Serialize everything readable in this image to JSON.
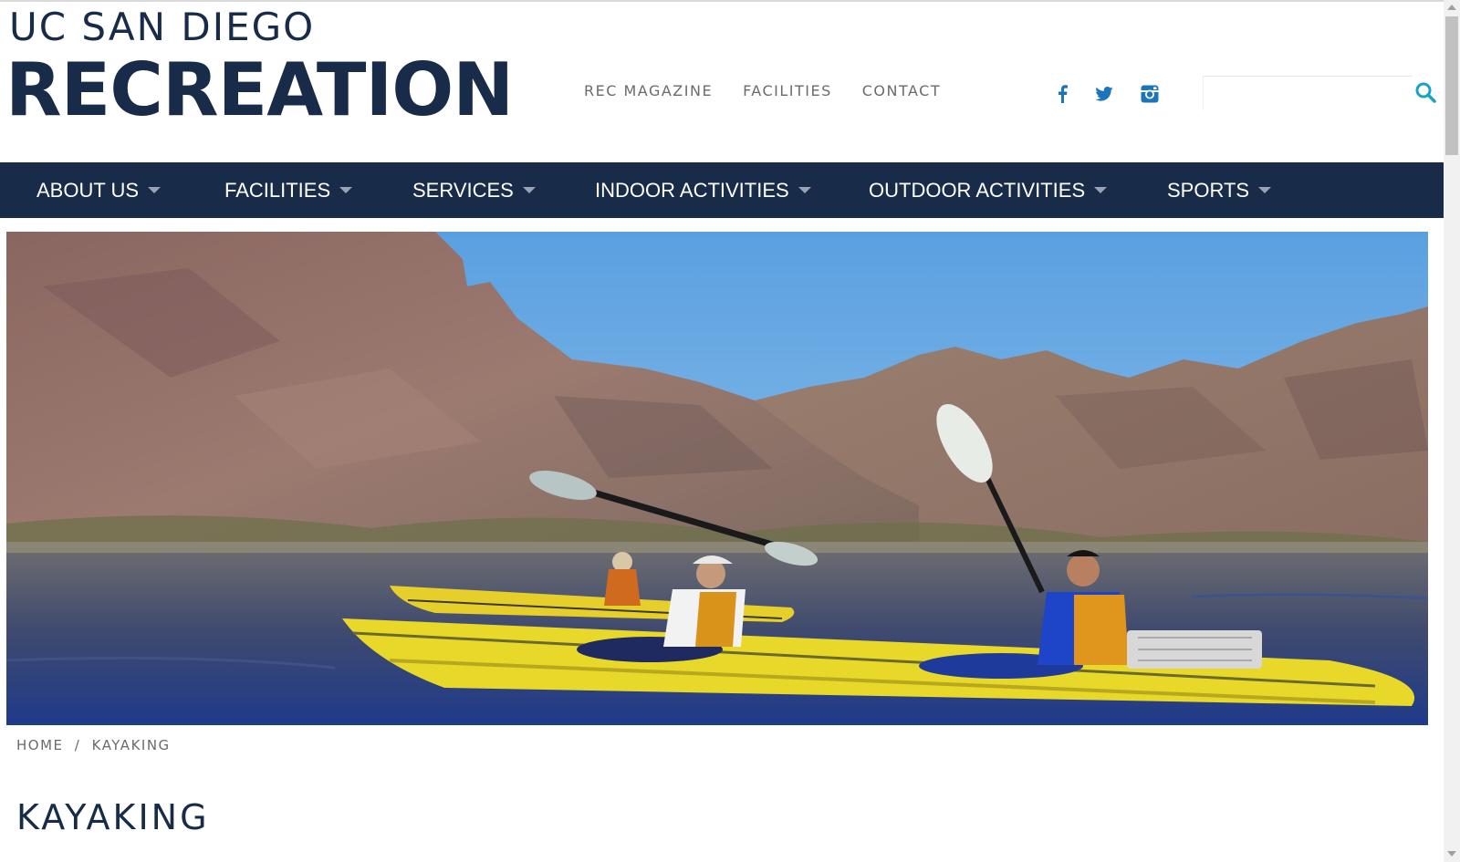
{
  "header": {
    "logo_line1": "UC SAN DIEGO",
    "logo_line2": "RECREATION",
    "util_links": [
      "REC MAGAZINE",
      "FACILITIES",
      "CONTACT"
    ],
    "social_icons": [
      "facebook-icon",
      "twitter-icon",
      "instagram-icon"
    ],
    "search_value": "",
    "search_icon": "search-icon"
  },
  "nav": {
    "items": [
      {
        "label": "ABOUT US"
      },
      {
        "label": "FACILITIES"
      },
      {
        "label": "SERVICES"
      },
      {
        "label": "INDOOR ACTIVITIES"
      },
      {
        "label": "OUTDOOR ACTIVITIES"
      },
      {
        "label": "SPORTS"
      }
    ]
  },
  "breadcrumb": {
    "home": "HOME",
    "separator": "/",
    "current": "KAYAKING"
  },
  "page": {
    "title": "KAYAKING"
  },
  "colors": {
    "brand_navy": "#182b49",
    "accent_blue": "#1b75bc",
    "text_gray": "#6b6b6b"
  }
}
